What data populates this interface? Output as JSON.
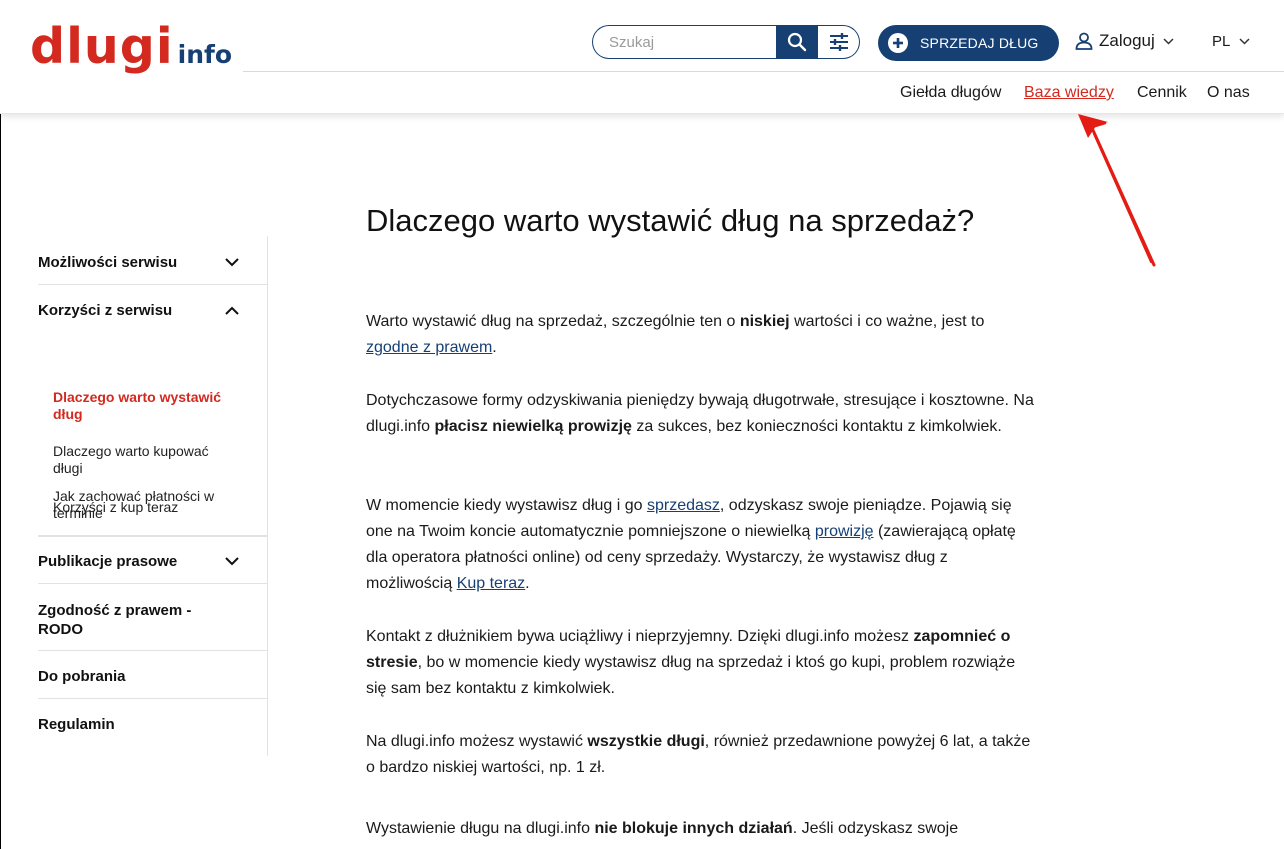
{
  "brand": {
    "logo_main": "dlugi",
    "logo_sub": "info",
    "accent_color": "#d3291f",
    "primary_color": "#163f74"
  },
  "header": {
    "search_placeholder": "Szukaj",
    "sell_button": "SPRZEDAJ DŁUG",
    "login_label": "Zaloguj",
    "language": "PL",
    "nav": [
      {
        "label": "Giełda długów",
        "active": false
      },
      {
        "label": "Baza wiedzy",
        "active": true
      },
      {
        "label": "Cennik",
        "active": false
      },
      {
        "label": "O nas",
        "active": false
      }
    ]
  },
  "sidebar": {
    "sections": [
      {
        "label": "Możliwości serwisu",
        "expanded": false
      },
      {
        "label": "Korzyści z serwisu",
        "expanded": true,
        "items": [
          {
            "label_line1": "Dlaczego warto wystawić",
            "label_line2": "dług",
            "active": true
          },
          {
            "label_line1": "Dlaczego warto kupować",
            "label_line2": "długi",
            "active": false
          },
          {
            "label_line1": "Korzyści z kup teraz",
            "label_line2": "",
            "active": false
          },
          {
            "label_line1": "Jak zachować płatności w",
            "label_line2": "terminie",
            "active": false
          }
        ]
      },
      {
        "label": "Publikacje prasowe",
        "expanded": false
      },
      {
        "label_line1": "Zgodność z prawem -",
        "label_line2": "RODO"
      },
      {
        "label": "Do pobrania"
      },
      {
        "label": "Regulamin"
      }
    ]
  },
  "article": {
    "title": "Dlaczego warto wystawić dług na sprzedaż?",
    "p1": {
      "t1": "Warto wystawić dług na sprzedaż, szczególnie ten o ",
      "b1": "niskiej",
      "t2": " wartości i co ważne, jest to ",
      "link1": "zgodne z prawem",
      "t3": "."
    },
    "p2": {
      "t1": "Dotychczasowe formy odzyskiwania pieniędzy bywają długotrwałe, stresujące i kosztowne. Na dlugi.info ",
      "b1": "płacisz niewielką prowizję",
      "t2": " za sukces, bez konieczności kontaktu z kimkolwiek."
    },
    "p3": {
      "t1": "W momencie kiedy wystawisz dług i go ",
      "link1": "sprzedasz",
      "t2": ", odzyskasz swoje pieniądze. Pojawią się one na Twoim koncie automatycznie pomniejszone o niewielką ",
      "link2": "prowizję",
      "t3": " (zawierającą opłatę dla operatora płatności online) od ceny sprzedaży. Wystarczy, że wystawisz dług z możliwością ",
      "link3": "Kup teraz",
      "t4": "."
    },
    "p4": {
      "t1": "Kontakt z dłużnikiem bywa uciążliwy i nieprzyjemny. Dzięki dlugi.info możesz ",
      "b1": "zapomnieć o stresie",
      "t2": ", bo w momencie kiedy wystawisz dług na sprzedaż i ktoś go kupi, problem rozwiąże się sam bez kontaktu z kimkolwiek."
    },
    "p5": {
      "t1": "Na dlugi.info możesz wystawić ",
      "b1": "wszystkie długi",
      "t2": ", również przedawnione powyżej 6 lat, a także o bardzo niskiej wartości, np. 1 zł."
    },
    "p6": {
      "t1": "Wystawienie długu na dlugi.info ",
      "b1": "nie blokuje innych działań",
      "t2": ". Jeśli odzyskasz swoje"
    }
  }
}
